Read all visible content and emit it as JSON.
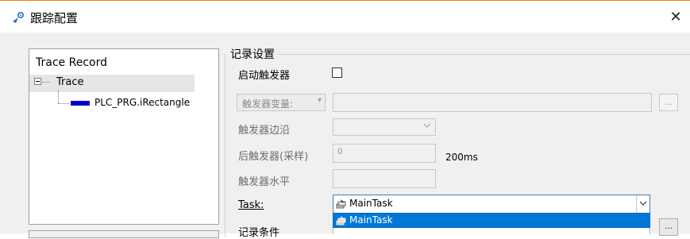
{
  "window": {
    "title": "跟踪配置",
    "close_symbol": "✕",
    "accent": "#f08300"
  },
  "tree": {
    "root_label": "Trace Record",
    "expander_symbol": "−",
    "trace_label": "Trace",
    "variable": {
      "label": "PLC_PRG.iRectangle",
      "color": "#0000cc"
    }
  },
  "record_settings": {
    "group_title": "记录设置",
    "enable_trigger_label": "启动触发器",
    "enable_trigger_checked": false,
    "trigger_variable_combo": "触发器变量:",
    "trigger_variable_value": "",
    "ellipsis_label": "...",
    "trigger_edge_label": "触发器边沿",
    "post_trigger_label": "后触发器(采样)",
    "post_trigger_value": "0",
    "post_trigger_unit": "200ms",
    "trigger_level_label": "触发器水平",
    "task_label": "Task:",
    "task_value": "MainTask",
    "task_options": [
      "MainTask"
    ],
    "record_condition_label": "记录条件"
  },
  "colors": {
    "highlight": "#0078d7"
  }
}
